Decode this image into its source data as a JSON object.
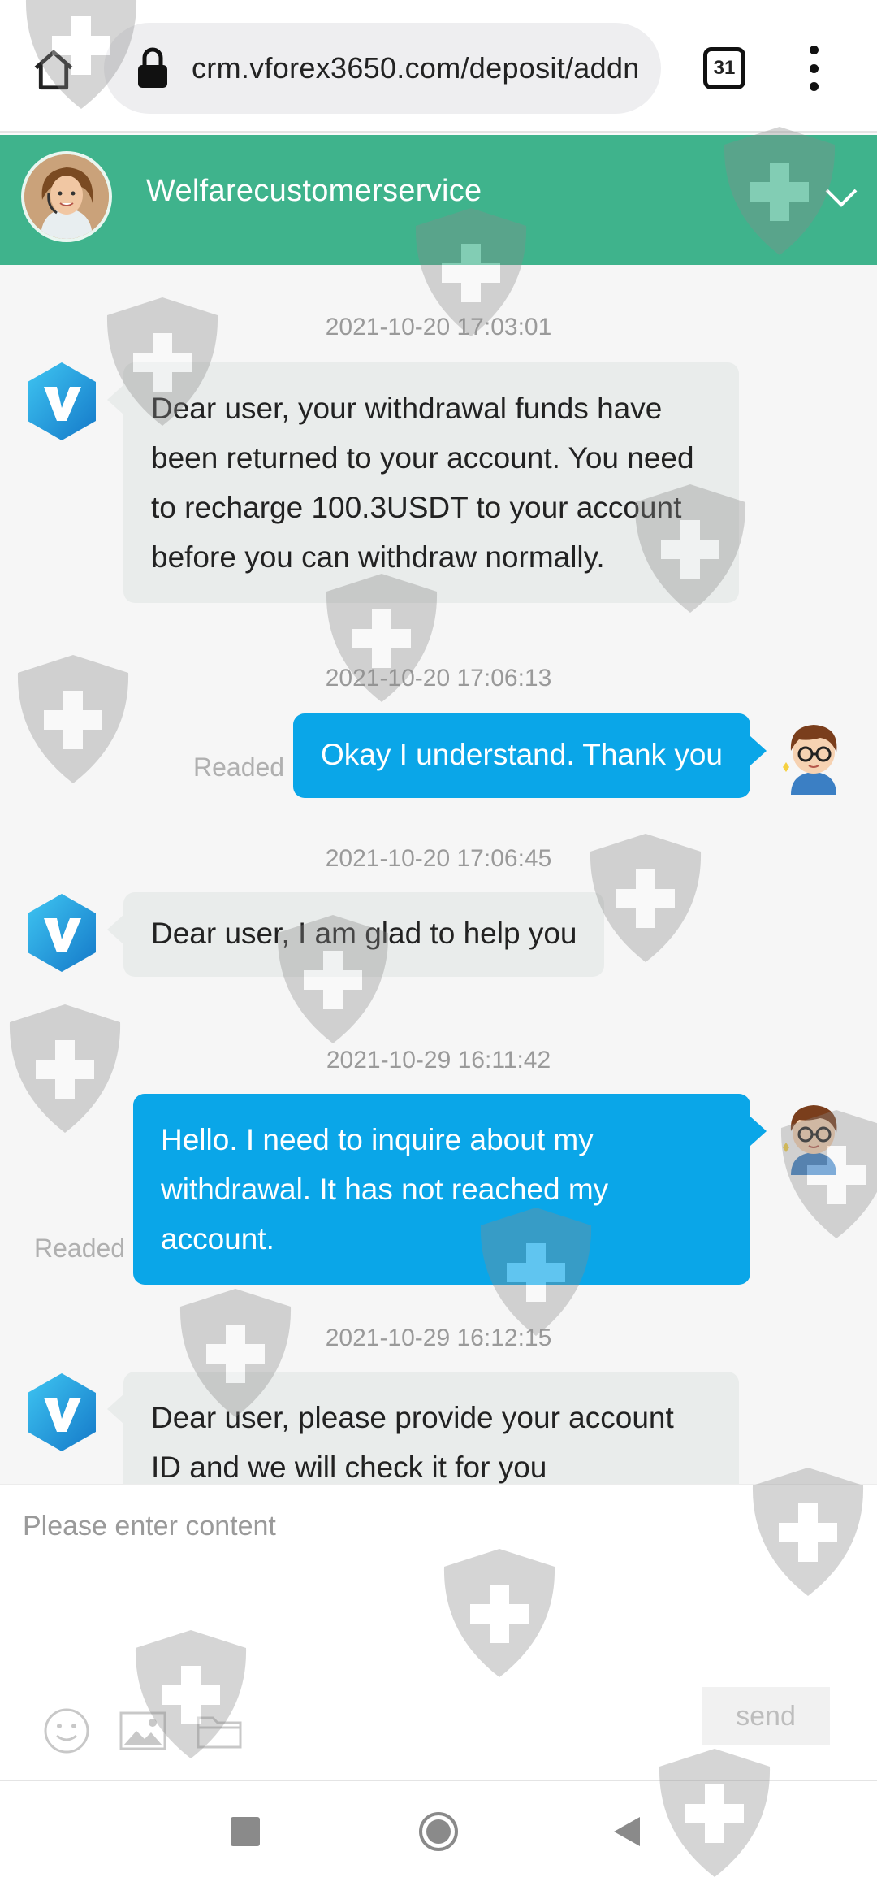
{
  "browser": {
    "url": "crm.vforex3650.com/deposit/addn",
    "tab_count": "31"
  },
  "header": {
    "agent_name": "Welfarecustomerservice"
  },
  "messages": [
    {
      "timestamp": "2021-10-20 17:03:01",
      "direction": "in",
      "text": "Dear user, your withdrawal funds have been returned to your account. You need to recharge 100.3USDT to your account before you can withdraw normally."
    },
    {
      "timestamp": "2021-10-20 17:06:13",
      "direction": "out",
      "text": "Okay I understand. Thank you",
      "status": "Readed"
    },
    {
      "timestamp": "2021-10-20 17:06:45",
      "direction": "in",
      "text": "Dear user, I am glad to help you"
    },
    {
      "timestamp": "2021-10-29 16:11:42",
      "direction": "out",
      "text": "Hello. I need to inquire about my withdrawal. It has not reached my account.",
      "status": "Readed"
    },
    {
      "timestamp": "2021-10-29 16:12:15",
      "direction": "in",
      "text": "Dear user, please provide your account ID and we will check it for you"
    }
  ],
  "composer": {
    "placeholder": "Please enter content",
    "send_label": "send"
  },
  "colors": {
    "header_green": "#3fb38c",
    "outgoing_blue": "#0aa6e8",
    "incoming_gray": "#e9eceb"
  },
  "icons": [
    "home-icon",
    "lock-icon",
    "tabs-icon",
    "more-icon",
    "chevron-down-icon",
    "emoji-icon",
    "image-icon",
    "folder-icon",
    "recents-icon",
    "home-nav-icon",
    "back-icon"
  ]
}
